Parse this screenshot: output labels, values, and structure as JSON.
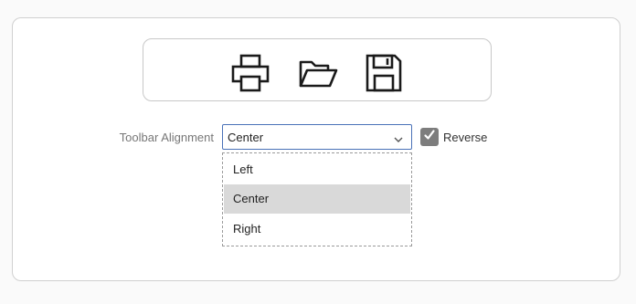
{
  "toolbar": {
    "buttons": [
      {
        "icon": "printer-icon"
      },
      {
        "icon": "folder-open-icon"
      },
      {
        "icon": "floppy-disk-icon"
      }
    ]
  },
  "alignment": {
    "label": "Toolbar Alignment",
    "selected_value": "Center",
    "options": [
      "Left",
      "Center",
      "Right"
    ]
  },
  "reverse": {
    "label": "Reverse",
    "checked": true
  },
  "colors": {
    "accent_border": "#4a72b8",
    "checkbox_fill": "#7d7d7d",
    "selected_option_bg": "#d9d9d9"
  }
}
